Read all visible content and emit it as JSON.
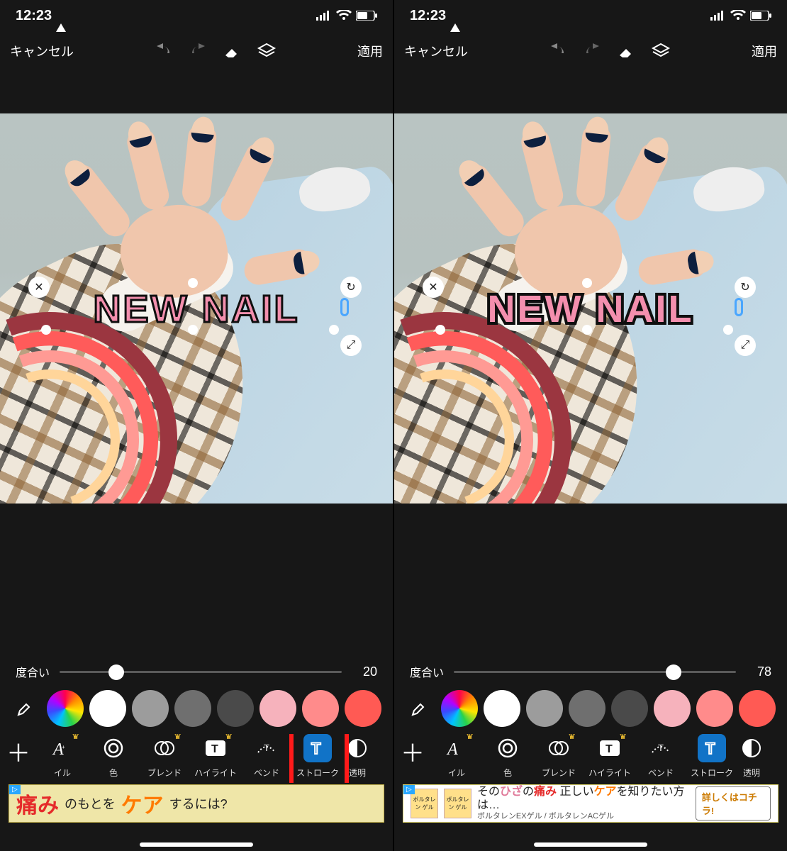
{
  "status": {
    "time": "12:23"
  },
  "topbar": {
    "cancel": "キャンセル",
    "apply": "適用"
  },
  "text_overlay": "NEW NAIL",
  "slider": {
    "label": "度合い"
  },
  "left": {
    "slider_value": "20",
    "thumb_pct": 20
  },
  "right": {
    "slider_value": "78",
    "thumb_pct": 78
  },
  "swatches": [
    "rainbow",
    "#ffffff",
    "#9c9c9c",
    "#6f6f6f",
    "#4a4a4a",
    "#f6b2bc",
    "#ff8b8b",
    "#ff5a54"
  ],
  "tools": {
    "style": {
      "label": "イル"
    },
    "color": {
      "label": "色"
    },
    "blend": {
      "label": "ブレンド"
    },
    "highlight": {
      "label": "ハイライト"
    },
    "bend": {
      "label": "ベンド"
    },
    "stroke": {
      "label": "ストローク"
    },
    "opacity": {
      "label": "透明"
    }
  },
  "ad_left": {
    "w1": "痛み",
    "mid": "のもとを",
    "w2": "ケア",
    "tail": "するには?"
  },
  "ad_right": {
    "box": "ボルタレン ゲル",
    "line1_a": "その",
    "line1_b": "ひざ",
    "line1_c": "の",
    "line1_d": "痛み",
    "line1_e": " 正しい",
    "line1_f": "ケア",
    "line1_g": "を知りたい方は…",
    "line2": "ボルタレンEXゲル / ボルタレンACゲル",
    "btn": "詳しくはコチラ!"
  }
}
